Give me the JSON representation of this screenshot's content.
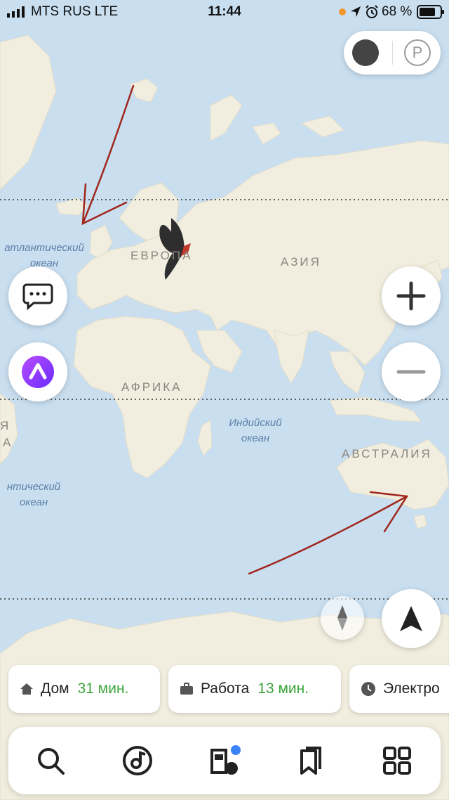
{
  "status_bar": {
    "carrier": "MTS RUS   LTE",
    "time": "11:44",
    "battery_percent": "68 %",
    "icons": [
      "signal-icon",
      "orange-dot-icon",
      "location-arrow-icon",
      "alarm-icon",
      "battery-icon"
    ]
  },
  "map": {
    "continent_labels": {
      "europe": "ЕВРОПА",
      "asia": "АЗИЯ",
      "africa": "АФРИКА",
      "australia": "АВСТРАЛИЯ"
    },
    "ocean_labels": {
      "atlantic_1_line1": "атлантический",
      "atlantic_1_line2": "океан",
      "atlantic_2_line1": "нтический",
      "atlantic_2_line2": "океан",
      "indian_line1": "Индийский",
      "indian_line2": "океан"
    },
    "partial_labels": {
      "left_1": "Я",
      "left_2": "А"
    },
    "colors": {
      "water": "#c9dff0",
      "land": "#f1eedf",
      "arrow": "#a0261c"
    }
  },
  "controls": {
    "top_pill_icons": [
      "theme-icon",
      "parking-icon"
    ],
    "parking_glyph": "P",
    "left_buttons": [
      "chat-icon",
      "alice-icon"
    ],
    "right_buttons": [
      "zoom-in-icon",
      "zoom-out-icon",
      "compass-icon",
      "my-location-icon"
    ]
  },
  "quick_routes": [
    {
      "label": "Дом",
      "eta": "31 мин.",
      "icon": "home-icon"
    },
    {
      "label": "Работа",
      "eta": "13 мин.",
      "icon": "briefcase-icon"
    },
    {
      "label": "Электро",
      "eta": "",
      "icon": "clock-icon"
    }
  ],
  "bottom_tabs": [
    "search-icon",
    "music-icon",
    "fuel-icon",
    "bookmarks-icon",
    "services-grid-icon"
  ]
}
